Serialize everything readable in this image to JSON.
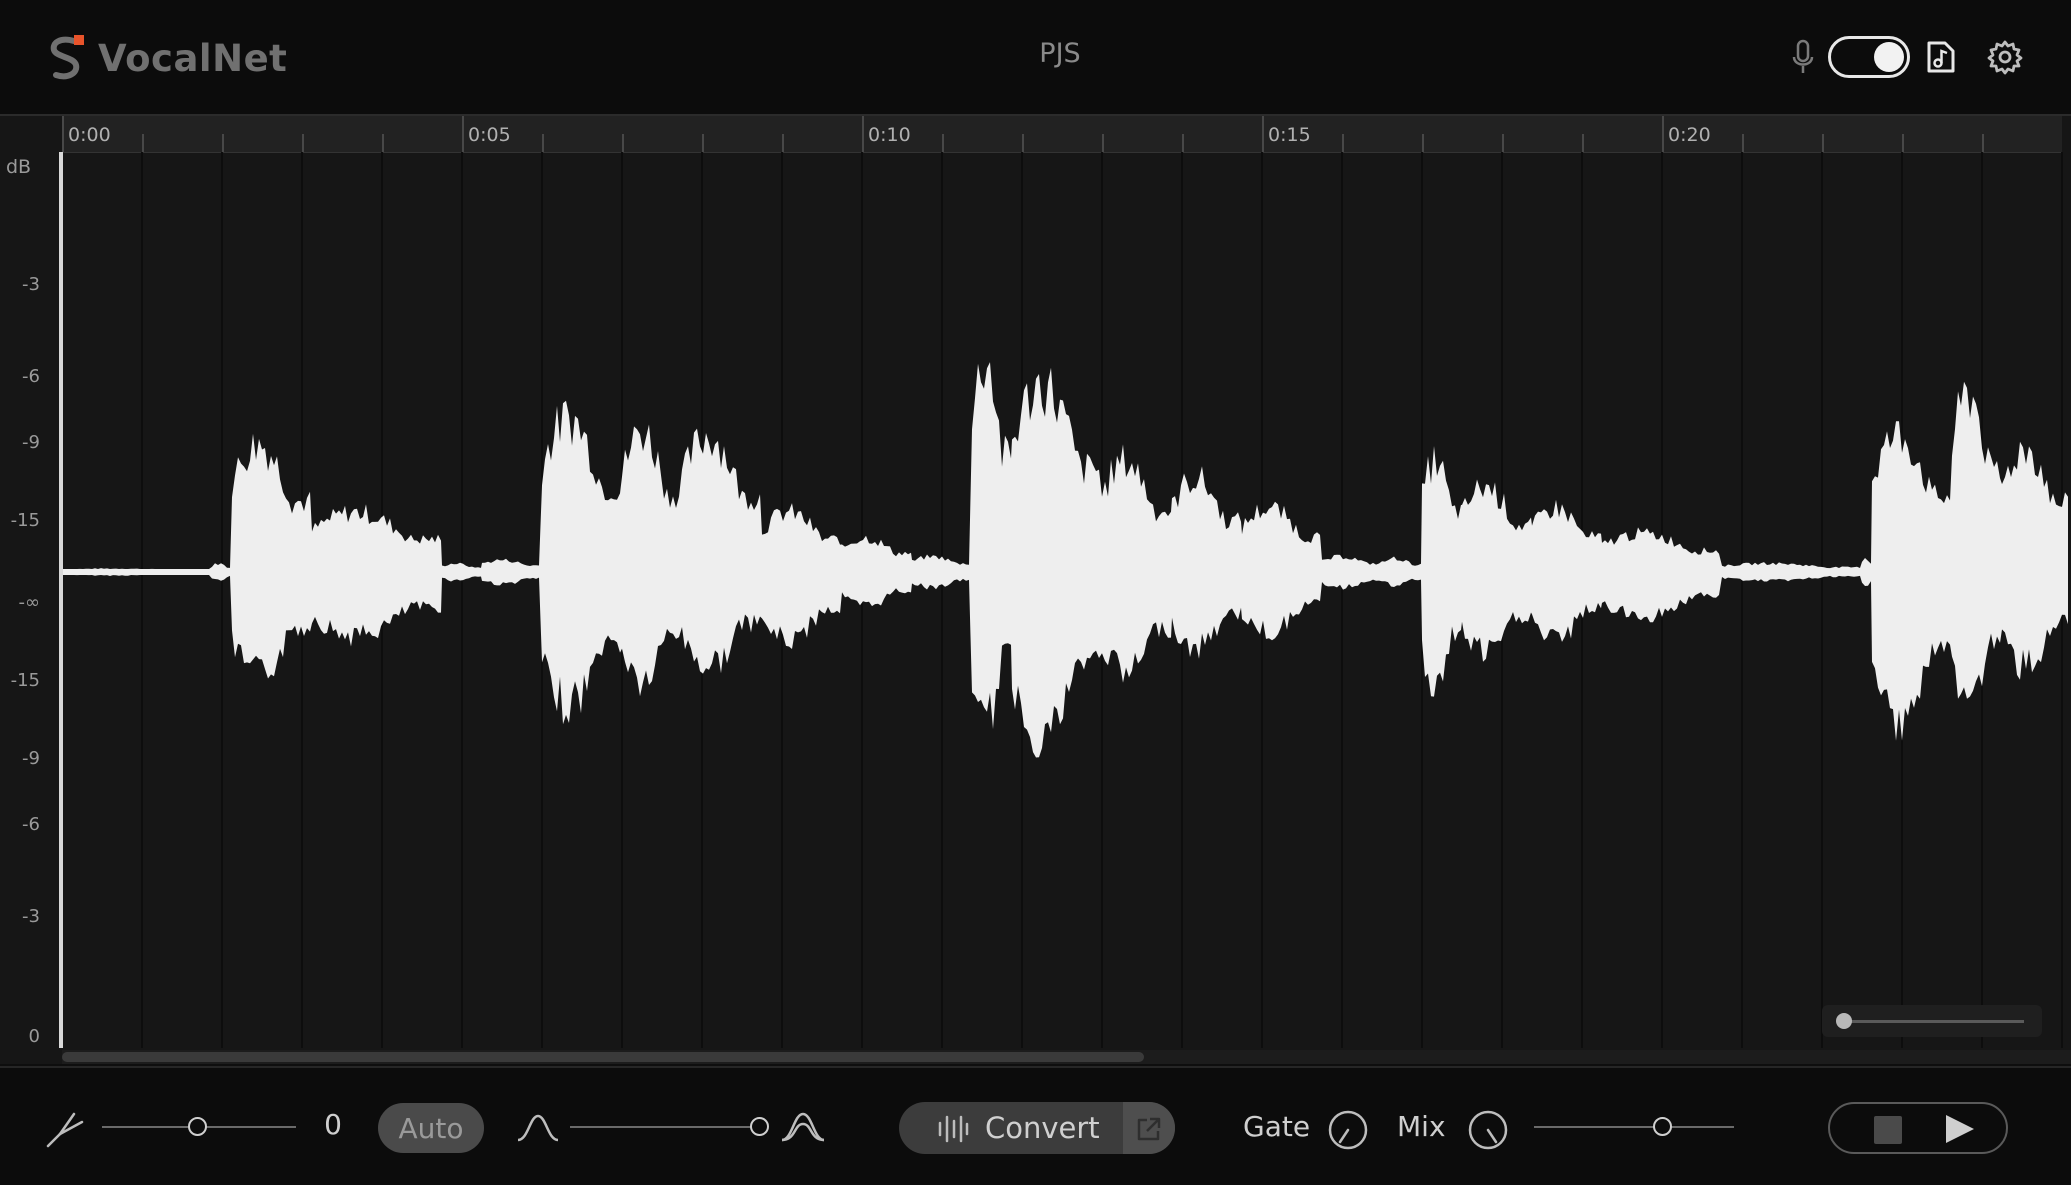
{
  "app": {
    "name": "VocalNet",
    "project": "PJS"
  },
  "header": {
    "icons": [
      "microphone-icon",
      "music-file-icon",
      "gear-icon"
    ],
    "toggle_on": true
  },
  "timeline": {
    "time_labels": [
      "0:00",
      "0:05",
      "0:10",
      "0:15",
      "0:20"
    ],
    "db_unit": "dB",
    "db_labels": [
      "-3",
      "-6",
      "-9",
      "-15",
      "-∞",
      "-15",
      "-9",
      "-6",
      "-3",
      "0"
    ],
    "zoom_level": 0.0
  },
  "footer": {
    "pitch_value": "0",
    "pitch_slider": 0.5,
    "auto_label": "Auto",
    "formant_slider": 1.0,
    "convert_label": "Convert",
    "gate_label": "Gate",
    "mix_label": "Mix",
    "mix_slider": 0.64
  },
  "colors": {
    "accent": "#e8542b",
    "waveform": "#eeeeee",
    "background": "#161616"
  }
}
